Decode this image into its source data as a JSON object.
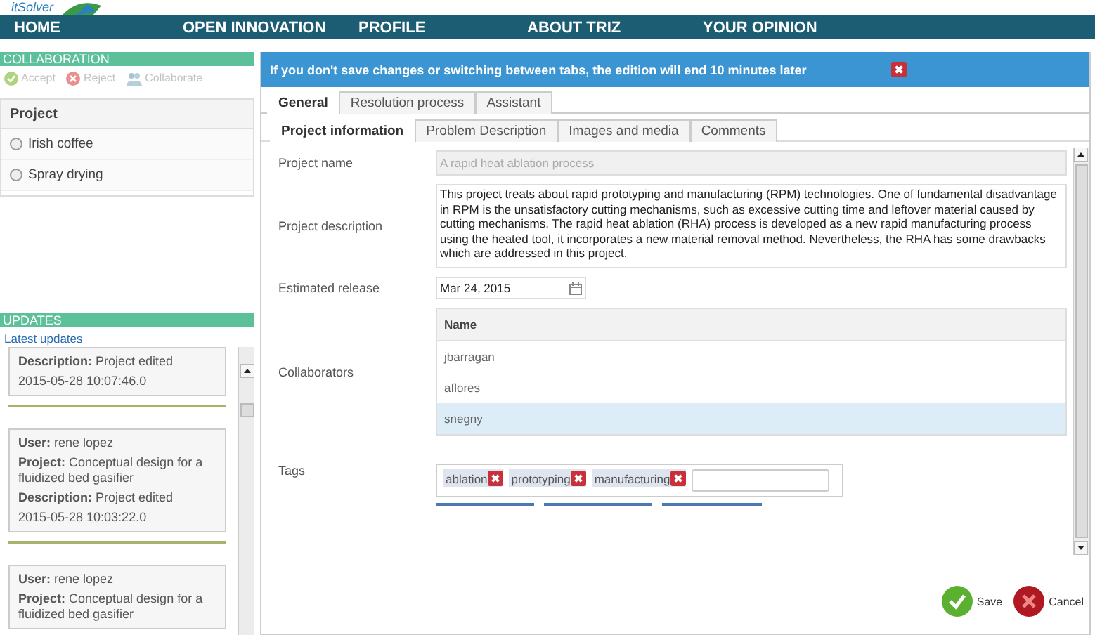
{
  "logo": "itSolver",
  "nav": [
    "HOME",
    "OPEN INNOVATION",
    "PROFILE",
    "ABOUT TRIZ",
    "YOUR OPINION"
  ],
  "collaboration": {
    "title": "COLLABORATION",
    "actions": [
      {
        "kind": "accept",
        "label": "Accept",
        "disabled": true
      },
      {
        "kind": "reject",
        "label": "Reject",
        "disabled": true
      },
      {
        "kind": "collaborate",
        "label": "Collaborate",
        "disabled": true
      }
    ]
  },
  "projects": {
    "header": "Project",
    "items": [
      {
        "label": "Irish coffee",
        "selected": false
      },
      {
        "label": "Spray drying",
        "selected": false
      }
    ]
  },
  "updates": {
    "title": "UPDATES",
    "subtitle": "Latest updates",
    "items": [
      {
        "lines": [
          "**Description:** Project edited",
          "2015-05-28 10:07:46.0"
        ]
      },
      {
        "lines": [
          "**User:** rene lopez",
          "**Project:** Conceptual design for a fluidized bed gasifier",
          "**Description:** Project edited",
          "2015-05-28 10:03:22.0"
        ]
      },
      {
        "lines": [
          "**User:** rene lopez",
          "**Project:** Conceptual design for a fluidized bed gasifier"
        ]
      }
    ]
  },
  "banner": "If you don't save changes or switching between tabs, the edition will end 10 minutes later",
  "tabs": [
    {
      "label": "General",
      "selected": true
    },
    {
      "label": "Resolution process",
      "selected": false
    },
    {
      "label": "Assistant",
      "selected": false
    }
  ],
  "subtabs": [
    {
      "label": "Project information",
      "selected": true
    },
    {
      "label": "Problem Description",
      "selected": false
    },
    {
      "label": "Images and media",
      "selected": false
    },
    {
      "label": "Comments",
      "selected": false
    }
  ],
  "form": {
    "project_name": {
      "label": "Project name",
      "value": "A rapid heat ablation process",
      "disabled": true
    },
    "project_description": {
      "label": "Project description",
      "value": "This project treats about rapid prototyping and manufacturing (RPM) technologies. One of fundamental disadvantage in RPM is the unsatisfactory cutting mechanisms, such as excessive cutting time and leftover material caused by cutting mechanisms. The rapid heat ablation (RHA) process is developed as a new rapid manufacturing process using the heated tool, it incorporates a new material removal method. Nevertheless, the RHA has some drawbacks which are addressed in this project."
    },
    "estimated_release": {
      "label": "Estimated release",
      "value": "Mar 24, 2015"
    },
    "collaborators": {
      "label": "Collaborators",
      "column": "Name",
      "rows": [
        {
          "name": "jbarragan",
          "selected": false
        },
        {
          "name": "aflores",
          "selected": false
        },
        {
          "name": "snegny",
          "selected": true
        }
      ]
    },
    "tags": {
      "label": "Tags",
      "items": [
        "ablation",
        "prototyping",
        "manufacturing"
      ]
    }
  },
  "buttons": [
    {
      "kind": "save",
      "label": "Save"
    },
    {
      "kind": "cancel",
      "label": "Cancel"
    }
  ]
}
